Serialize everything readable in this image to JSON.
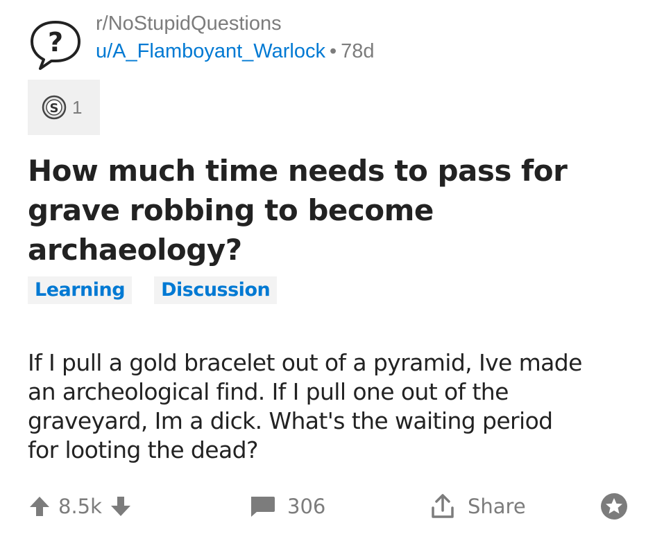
{
  "post": {
    "subreddit": "r/NoStupidQuestions",
    "author": "u/A_Flamboyant_Warlock",
    "separator": "•",
    "age": "78d",
    "award_count": "1",
    "title": "How much time needs to pass for grave robbing to become archaeology?",
    "flairs": [
      "Learning",
      "Discussion"
    ],
    "body_lines": [
      "If I pull a gold bracelet out of a pyramid, Ive made",
      "an archeological find.  If I pull one out of the",
      "graveyard, Im a dick.  What's the waiting period",
      "for looting the dead?"
    ]
  },
  "actions": {
    "score": "8.5k",
    "comments": "306",
    "share_label": "Share"
  },
  "colors": {
    "link": "#0079d3",
    "muted": "#7c7c7c",
    "text": "#222222",
    "flair_bg": "#f3f3f3"
  },
  "icons": [
    "question-mark-icon",
    "silver-award-icon",
    "upvote-icon",
    "downvote-icon",
    "comment-icon",
    "share-icon",
    "save-star-icon"
  ]
}
